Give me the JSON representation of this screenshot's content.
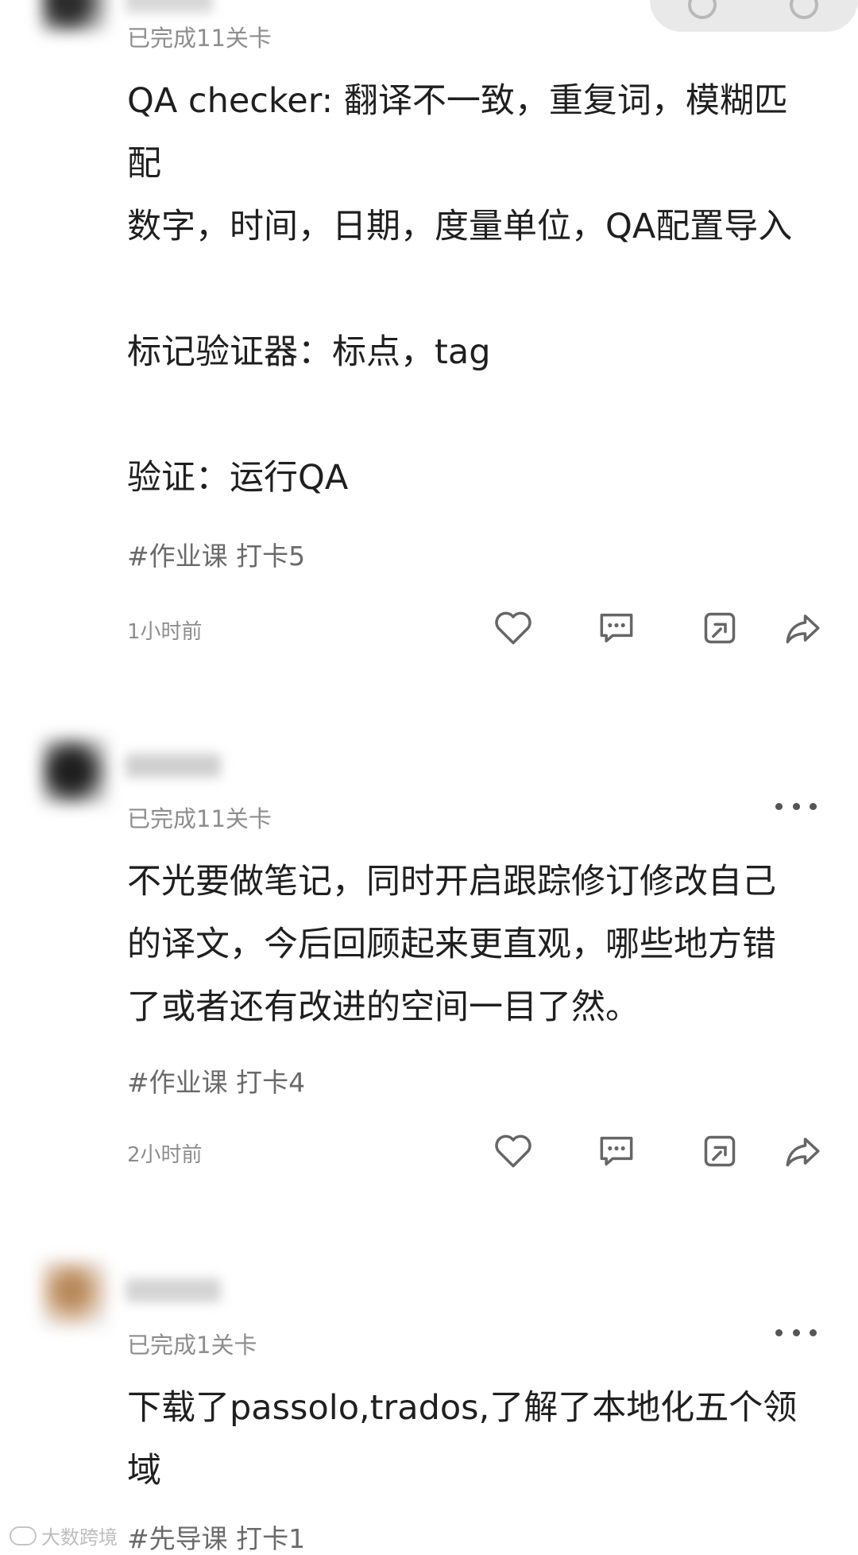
{
  "posts": [
    {
      "level": "已完成11关卡",
      "lines": [
        "QA checker: 翻译不一致，重复词，模糊匹",
        "配",
        "数字，时间，日期，度量单位，QA配置导入",
        "",
        "标记验证器：标点，tag",
        "",
        "验证：运行QA"
      ],
      "topic": "#作业课 打卡5",
      "time": "1小时前"
    },
    {
      "level": "已完成11关卡",
      "lines": [
        "不光要做笔记，同时开启跟踪修订修改自己",
        "的译文，今后回顾起来更直观，哪些地方错",
        "了或者还有改进的空间一目了然。"
      ],
      "topic": "#作业课 打卡4",
      "time": "2小时前"
    },
    {
      "level": "已完成1关卡",
      "lines": [
        "下载了passolo,trados,了解了本地化五个领",
        "域"
      ],
      "topic": "#先导课 打卡1"
    }
  ],
  "watermark": "大数跨境",
  "icons": {
    "like": "heart-icon",
    "comment": "comment-icon",
    "repost": "repost-icon",
    "share": "share-arrow-icon",
    "more": "more-dots-icon"
  },
  "colors": {
    "icon": "#666666",
    "meta_text": "#8d8d8d",
    "topic_text": "#6a6a6a",
    "body_text": "#1f1f1f"
  }
}
